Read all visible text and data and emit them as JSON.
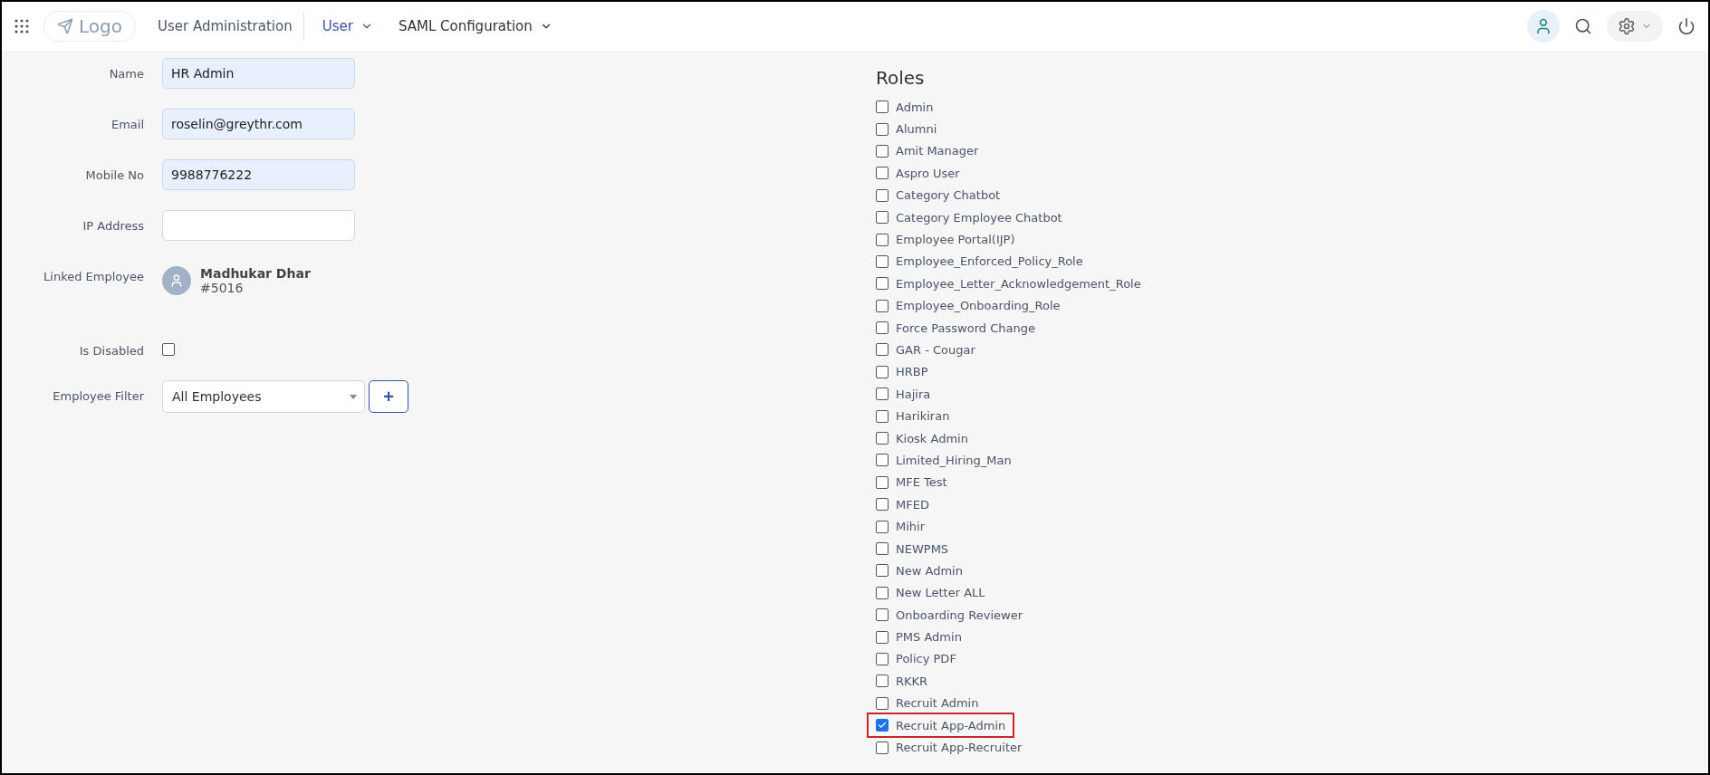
{
  "topbar": {
    "logo": "Logo",
    "breadcrumb": "User Administration",
    "menus": [
      {
        "label": "User",
        "selected": true
      },
      {
        "label": "SAML Configuration",
        "selected": false
      }
    ]
  },
  "form": {
    "fields": [
      {
        "kind": "text",
        "label": "Name",
        "value": "HR Admin",
        "filled": true
      },
      {
        "kind": "text",
        "label": "Email",
        "value": "roselin@greythr.com",
        "filled": true
      },
      {
        "kind": "text",
        "label": "Mobile No",
        "value": "9988776222",
        "filled": true
      },
      {
        "kind": "text",
        "label": "IP Address",
        "filled": false
      },
      {
        "kind": "employee",
        "label": "Linked Employee",
        "name": "Madhukar Dhar",
        "code": "#5016"
      },
      {
        "kind": "checkbox",
        "label": "Is Disabled",
        "checked": false
      },
      {
        "kind": "select",
        "label": "Employee Filter",
        "value": "All Employees",
        "button": "+"
      }
    ]
  },
  "roles": {
    "title": "Roles",
    "items": [
      {
        "label": "Admin",
        "checked": false,
        "highlighted": false
      },
      {
        "label": "Alumni",
        "checked": false,
        "highlighted": false
      },
      {
        "label": "Amit Manager",
        "checked": false,
        "highlighted": false
      },
      {
        "label": "Aspro User",
        "checked": false,
        "highlighted": false
      },
      {
        "label": "Category Chatbot",
        "checked": false,
        "highlighted": false
      },
      {
        "label": "Category Employee Chatbot",
        "checked": false,
        "highlighted": false
      },
      {
        "label": "Employee Portal(IJP)",
        "checked": false,
        "highlighted": false
      },
      {
        "label": "Employee_Enforced_Policy_Role",
        "checked": false,
        "highlighted": false
      },
      {
        "label": "Employee_Letter_Acknowledgement_Role",
        "checked": false,
        "highlighted": false
      },
      {
        "label": "Employee_Onboarding_Role",
        "checked": false,
        "highlighted": false
      },
      {
        "label": "Force Password Change",
        "checked": false,
        "highlighted": false
      },
      {
        "label": "GAR - Cougar",
        "checked": false,
        "highlighted": false
      },
      {
        "label": "HRBP",
        "checked": false,
        "highlighted": false
      },
      {
        "label": "Hajira",
        "checked": false,
        "highlighted": false
      },
      {
        "label": "Harikiran",
        "checked": false,
        "highlighted": false
      },
      {
        "label": "Kiosk Admin",
        "checked": false,
        "highlighted": false
      },
      {
        "label": "Limited_Hiring_Man",
        "checked": false,
        "highlighted": false
      },
      {
        "label": "MFE Test",
        "checked": false,
        "highlighted": false
      },
      {
        "label": "MFED",
        "checked": false,
        "highlighted": false
      },
      {
        "label": "Mihir",
        "checked": false,
        "highlighted": false
      },
      {
        "label": "NEWPMS",
        "checked": false,
        "highlighted": false
      },
      {
        "label": "New Admin",
        "checked": false,
        "highlighted": false
      },
      {
        "label": "New Letter ALL",
        "checked": false,
        "highlighted": false
      },
      {
        "label": "Onboarding Reviewer",
        "checked": false,
        "highlighted": false
      },
      {
        "label": "PMS Admin",
        "checked": false,
        "highlighted": false
      },
      {
        "label": "Policy PDF",
        "checked": false,
        "highlighted": false
      },
      {
        "label": "RKKR",
        "checked": false,
        "highlighted": false
      },
      {
        "label": "Recruit Admin",
        "checked": false,
        "highlighted": false
      },
      {
        "label": "Recruit App-Admin",
        "checked": true,
        "highlighted": true
      },
      {
        "label": "Recruit App-Recruiter",
        "checked": false,
        "highlighted": false
      }
    ]
  }
}
